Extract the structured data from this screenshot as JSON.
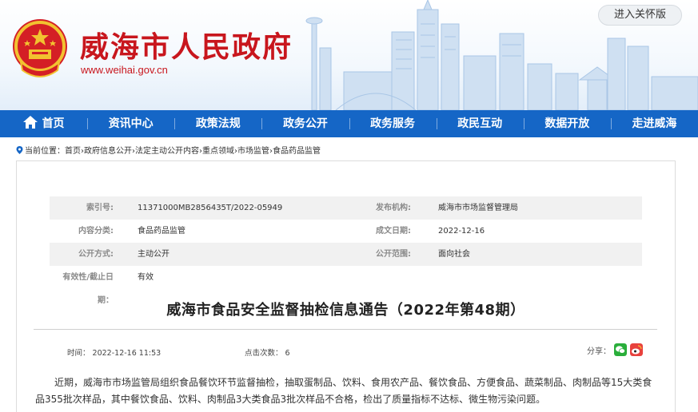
{
  "header": {
    "site_title": "威海市人民政府",
    "site_domain": "www.weihai.gov.cn",
    "care_mode_button": "进入关怀版",
    "colors": {
      "title_red": "#c8161d",
      "nav_blue": "#1566c6"
    }
  },
  "nav": {
    "items": [
      {
        "label": "首页",
        "icon": "home-icon"
      },
      {
        "label": "资讯中心"
      },
      {
        "label": "政策法规"
      },
      {
        "label": "政务公开"
      },
      {
        "label": "政务服务"
      },
      {
        "label": "政民互动"
      },
      {
        "label": "数据开放"
      },
      {
        "label": "走进威海"
      }
    ]
  },
  "breadcrumb": {
    "prefix": "当前位置：",
    "items": [
      "首页",
      "政府信息公开",
      "法定主动公开内容",
      "重点领域",
      "市场监管",
      "食品药品监管"
    ],
    "separator": "›"
  },
  "meta": {
    "rows": [
      {
        "label1": "索引号:",
        "value1": "11371000MB2856435T/2022-05949",
        "label2": "发布机构:",
        "value2": "威海市市场监督管理局"
      },
      {
        "label1": "内容分类:",
        "value1": "食品药品监管",
        "label2": "成文日期:",
        "value2": "2022-12-16"
      },
      {
        "label1": "公开方式:",
        "value1": "主动公开",
        "label2": "公开范围:",
        "value2": "面向社会"
      },
      {
        "label1": "有效性/截止日期：",
        "value1": "有效",
        "label2": "",
        "value2": ""
      }
    ]
  },
  "article": {
    "title": "威海市食品安全监督抽检信息通告（2022年第48期）",
    "time_label": "时间：",
    "time_value": "2022-12-16 11:53",
    "clicks_label": "点击次数：",
    "clicks_value": "6",
    "share_label": "分享：",
    "share_icons": [
      "wechat-icon",
      "weibo-icon"
    ],
    "body": "近期，威海市市场监管局组织食品餐饮环节监督抽检，抽取蛋制品、饮料、食用农产品、餐饮食品、方便食品、蔬菜制品、肉制品等15大类食品355批次样品，其中餐饮食品、饮料、肉制品3大类食品3批次样品不合格，检出了质量指标不达标、微生物污染问题。"
  }
}
